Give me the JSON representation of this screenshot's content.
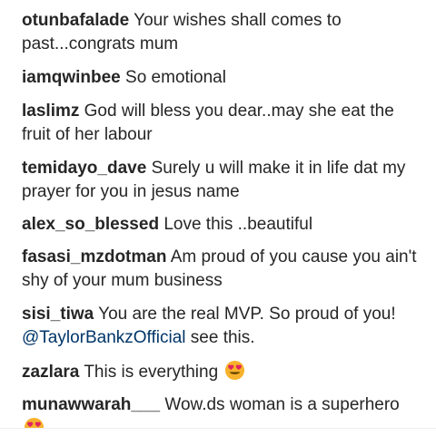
{
  "comments": [
    {
      "username": "otunbafalade",
      "text": "Your wishes shall comes to past...congrats mum"
    },
    {
      "username": "iamqwinbee",
      "text": "So emotional"
    },
    {
      "username": "laslimz",
      "text": "God will bless you dear..may she eat the fruit of her labour"
    },
    {
      "username": "temidayo_dave",
      "text": "Surely u will make it in life dat my prayer for you in jesus name"
    },
    {
      "username": "alex_so_blessed",
      "text": "Love this ..beautiful"
    },
    {
      "username": "fasasi_mzdotman",
      "text": "Am proud of you cause you ain't shy of your mum business"
    },
    {
      "username": "sisi_tiwa",
      "text": "You are the real MVP. So proud of you!",
      "mention": "@TaylorBankzOfficial",
      "text_after": "see this."
    },
    {
      "username": "zazlara",
      "text": "This is everything",
      "emoji": "heart-eyes-emoji"
    },
    {
      "username": "munawwarah___",
      "text": "Wow.ds woman is a superhero",
      "emoji": "heart-eyes-emoji"
    }
  ],
  "colors": {
    "text": "#262626",
    "mention": "#003569",
    "emoji_face": "#f7b22c",
    "emoji_heart": "#e0245e"
  }
}
